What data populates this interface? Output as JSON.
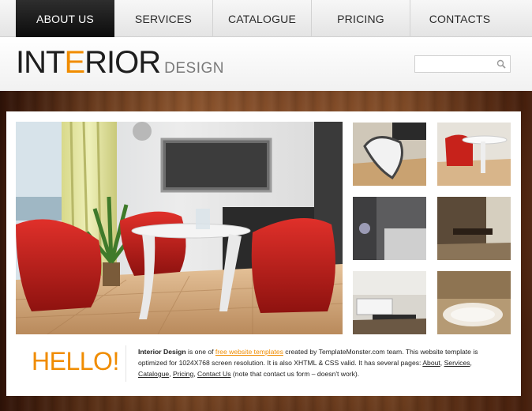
{
  "nav": {
    "items": [
      {
        "label": "ABOUT US",
        "active": true
      },
      {
        "label": "SERVICES",
        "active": false
      },
      {
        "label": "CATALOGUE",
        "active": false
      },
      {
        "label": "PRICING",
        "active": false
      },
      {
        "label": "CONTACTS",
        "active": false
      }
    ]
  },
  "header": {
    "logo_part1": "INT",
    "logo_accent": "E",
    "logo_part2": "RIOR",
    "logo_sub": "DESIGN",
    "search_value": "",
    "search_icon": "magnifier-icon"
  },
  "colors": {
    "accent": "#f08c00",
    "nav_active": "#111111",
    "text": "#222222"
  },
  "intro": {
    "hello": "HELLO!",
    "bold_name": "Interior Design",
    "t1": " is one of ",
    "link_free": "free website templates",
    "t2": " created by TemplateMonster.com team. This website template is optimized for 1024X768 screen resolution. It is also XHTML & CSS valid. It has several pages: ",
    "link_about": "About",
    "sep1": ", ",
    "link_services": "Services",
    "sep2": ", ",
    "link_catalogue": "Catalogue",
    "sep3": ", ",
    "link_pricing": "Pricing",
    "sep4": ", ",
    "link_contact": "Contact Us",
    "t3": " (note that contact us form – doesn't work)."
  }
}
